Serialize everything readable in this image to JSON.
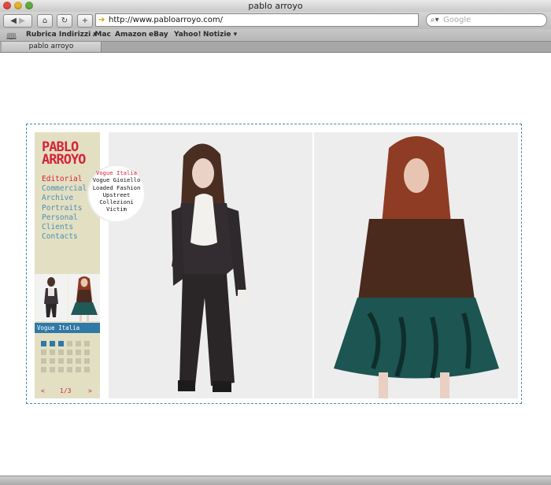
{
  "window": {
    "title": "pablo arroyo"
  },
  "toolbar": {
    "url": "http://www.pabloarroyo.com/",
    "search_placeholder": "Google"
  },
  "bookmarks": [
    "Rubrica Indirizzi ▾",
    ".Mac",
    "Amazon",
    "eBay",
    "Yahoo!",
    "Notizie ▾"
  ],
  "tab": {
    "label": "pablo arroyo"
  },
  "site": {
    "logo_line1": "PABLO",
    "logo_line2": "ARROYO",
    "nav": [
      "Editorial",
      "Commercial",
      "Archive",
      "Portraits",
      "Personal",
      "Clients",
      "Contacts"
    ],
    "submenu": [
      "Vogue Italia",
      "Vogue Gioiello",
      "Loaded Fashion",
      "Upstreet",
      "Collezioni",
      "Victim"
    ],
    "section_title": "Vogue Italia",
    "pager": {
      "prev": "<",
      "page": "1/3",
      "next": ">"
    }
  },
  "colors": {
    "accent_red": "#d8233a",
    "accent_blue": "#2f78a8",
    "sidebar_bg": "#e2dfc3"
  }
}
